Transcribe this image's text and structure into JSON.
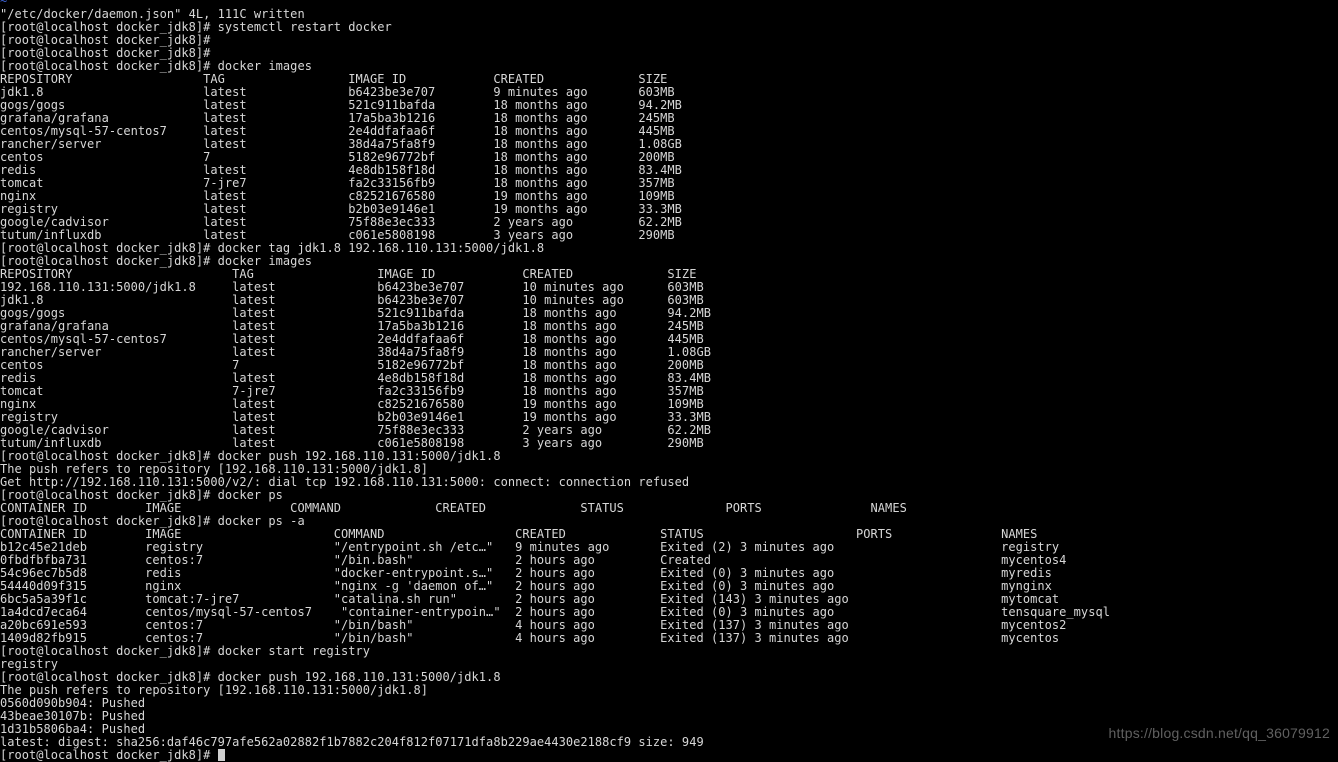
{
  "terminal": {
    "background_color": "#000000",
    "foreground_color": "#d7d7d7",
    "vim_tilde_color": "#3a5fcd",
    "hostname": "localhost",
    "user": "root",
    "working_dir": "docker_jdk8",
    "prompt": "[root@localhost docker_jdk8]# ",
    "vim_tilde": "~",
    "cursor": "block"
  },
  "watermark": {
    "text": "https://blog.csdn.net/qq_36079912",
    "color": "#606060"
  },
  "lines": [
    {
      "type": "tilde",
      "text": "~"
    },
    {
      "type": "output",
      "text": "\"/etc/docker/daemon.json\" 4L, 111C written"
    },
    {
      "type": "command",
      "text": "[root@localhost docker_jdk8]# systemctl restart docker"
    },
    {
      "type": "command",
      "text": "[root@localhost docker_jdk8]#"
    },
    {
      "type": "command",
      "text": "[root@localhost docker_jdk8]#"
    },
    {
      "type": "command",
      "text": "[root@localhost docker_jdk8]# docker images"
    },
    {
      "type": "header",
      "text": "REPOSITORY                  TAG                 IMAGE ID            CREATED             SIZE"
    },
    {
      "type": "output",
      "text": "jdk1.8                      latest              b6423be3e707        9 minutes ago       603MB"
    },
    {
      "type": "output",
      "text": "gogs/gogs                   latest              521c911bafda        18 months ago       94.2MB"
    },
    {
      "type": "output",
      "text": "grafana/grafana             latest              17a5ba3b1216        18 months ago       245MB"
    },
    {
      "type": "output",
      "text": "centos/mysql-57-centos7     latest              2e4ddfafaa6f        18 months ago       445MB"
    },
    {
      "type": "output",
      "text": "rancher/server              latest              38d4a75fa8f9        18 months ago       1.08GB"
    },
    {
      "type": "output",
      "text": "centos                      7                   5182e96772bf        18 months ago       200MB"
    },
    {
      "type": "output",
      "text": "redis                       latest              4e8db158f18d        18 months ago       83.4MB"
    },
    {
      "type": "output",
      "text": "tomcat                      7-jre7              fa2c33156fb9        18 months ago       357MB"
    },
    {
      "type": "output",
      "text": "nginx                       latest              c82521676580        19 months ago       109MB"
    },
    {
      "type": "output",
      "text": "registry                    latest              b2b03e9146e1        19 months ago       33.3MB"
    },
    {
      "type": "output",
      "text": "google/cadvisor             latest              75f88e3ec333        2 years ago         62.2MB"
    },
    {
      "type": "output",
      "text": "tutum/influxdb              latest              c061e5808198        3 years ago         290MB"
    },
    {
      "type": "command",
      "text": "[root@localhost docker_jdk8]# docker tag jdk1.8 192.168.110.131:5000/jdk1.8"
    },
    {
      "type": "command",
      "text": "[root@localhost docker_jdk8]# docker images"
    },
    {
      "type": "header",
      "text": "REPOSITORY                      TAG                 IMAGE ID            CREATED             SIZE"
    },
    {
      "type": "output",
      "text": "192.168.110.131:5000/jdk1.8     latest              b6423be3e707        10 minutes ago      603MB"
    },
    {
      "type": "output",
      "text": "jdk1.8                          latest              b6423be3e707        10 minutes ago      603MB"
    },
    {
      "type": "output",
      "text": "gogs/gogs                       latest              521c911bafda        18 months ago       94.2MB"
    },
    {
      "type": "output",
      "text": "grafana/grafana                 latest              17a5ba3b1216        18 months ago       245MB"
    },
    {
      "type": "output",
      "text": "centos/mysql-57-centos7         latest              2e4ddfafaa6f        18 months ago       445MB"
    },
    {
      "type": "output",
      "text": "rancher/server                  latest              38d4a75fa8f9        18 months ago       1.08GB"
    },
    {
      "type": "output",
      "text": "centos                          7                   5182e96772bf        18 months ago       200MB"
    },
    {
      "type": "output",
      "text": "redis                           latest              4e8db158f18d        18 months ago       83.4MB"
    },
    {
      "type": "output",
      "text": "tomcat                          7-jre7              fa2c33156fb9        18 months ago       357MB"
    },
    {
      "type": "output",
      "text": "nginx                           latest              c82521676580        19 months ago       109MB"
    },
    {
      "type": "output",
      "text": "registry                        latest              b2b03e9146e1        19 months ago       33.3MB"
    },
    {
      "type": "output",
      "text": "google/cadvisor                 latest              75f88e3ec333        2 years ago         62.2MB"
    },
    {
      "type": "output",
      "text": "tutum/influxdb                  latest              c061e5808198        3 years ago         290MB"
    },
    {
      "type": "command",
      "text": "[root@localhost docker_jdk8]# docker push 192.168.110.131:5000/jdk1.8"
    },
    {
      "type": "output",
      "text": "The push refers to repository [192.168.110.131:5000/jdk1.8]"
    },
    {
      "type": "output",
      "text": "Get http://192.168.110.131:5000/v2/: dial tcp 192.168.110.131:5000: connect: connection refused"
    },
    {
      "type": "command",
      "text": "[root@localhost docker_jdk8]# docker ps"
    },
    {
      "type": "header",
      "text": "CONTAINER ID        IMAGE               COMMAND             CREATED             STATUS              PORTS               NAMES"
    },
    {
      "type": "command",
      "text": "[root@localhost docker_jdk8]# docker ps -a"
    },
    {
      "type": "header",
      "text": "CONTAINER ID        IMAGE                     COMMAND                  CREATED             STATUS                     PORTS               NAMES"
    },
    {
      "type": "output",
      "text": "b12c45e21deb        registry                  \"/entrypoint.sh /etc…\"   9 minutes ago       Exited (2) 3 minutes ago                       registry"
    },
    {
      "type": "output",
      "text": "0fbdfbfba731        centos:7                  \"/bin.bash\"              2 hours ago         Created                                        mycentos4"
    },
    {
      "type": "output",
      "text": "54c96ec7b5d8        redis                     \"docker-entrypoint.s…\"   2 hours ago         Exited (0) 3 minutes ago                       myredis"
    },
    {
      "type": "output",
      "text": "54440d09f315        nginx                     \"nginx -g 'daemon of…\"   2 hours ago         Exited (0) 3 minutes ago                       mynginx"
    },
    {
      "type": "output",
      "text": "6bc5a5a39f1c        tomcat:7-jre7             \"catalina.sh run\"        2 hours ago         Exited (143) 3 minutes ago                     mytomcat"
    },
    {
      "type": "output",
      "text": "1a4dcd7eca64        centos/mysql-57-centos7    \"container-entrypoin…\"  2 hours ago         Exited (0) 3 minutes ago                       tensquare_mysql"
    },
    {
      "type": "output",
      "text": "a20bc691e593        centos:7                  \"/bin/bash\"              4 hours ago         Exited (137) 3 minutes ago                     mycentos2"
    },
    {
      "type": "output",
      "text": "1409d82fb915        centos:7                  \"/bin/bash\"              4 hours ago         Exited (137) 3 minutes ago                     mycentos"
    },
    {
      "type": "command",
      "text": "[root@localhost docker_jdk8]# docker start registry"
    },
    {
      "type": "output",
      "text": "registry"
    },
    {
      "type": "command",
      "text": "[root@localhost docker_jdk8]# docker push 192.168.110.131:5000/jdk1.8"
    },
    {
      "type": "output",
      "text": "The push refers to repository [192.168.110.131:5000/jdk1.8]"
    },
    {
      "type": "output",
      "text": "0560d090b904: Pushed"
    },
    {
      "type": "output",
      "text": "43beae30107b: Pushed"
    },
    {
      "type": "output",
      "text": "1d31b5806ba4: Pushed"
    },
    {
      "type": "output",
      "text": "latest: digest: sha256:daf46c797afe562a02882f1b7882c204f812f07171dfa8b229ae4430e2188cf9 size: 949"
    },
    {
      "type": "prompt-cursor",
      "text": "[root@localhost docker_jdk8]# "
    }
  ],
  "docker_images_first": {
    "command": "docker images",
    "columns": [
      "REPOSITORY",
      "TAG",
      "IMAGE ID",
      "CREATED",
      "SIZE"
    ],
    "rows": [
      [
        "jdk1.8",
        "latest",
        "b6423be3e707",
        "9 minutes ago",
        "603MB"
      ],
      [
        "gogs/gogs",
        "latest",
        "521c911bafda",
        "18 months ago",
        "94.2MB"
      ],
      [
        "grafana/grafana",
        "latest",
        "17a5ba3b1216",
        "18 months ago",
        "245MB"
      ],
      [
        "centos/mysql-57-centos7",
        "latest",
        "2e4ddfafaa6f",
        "18 months ago",
        "445MB"
      ],
      [
        "rancher/server",
        "latest",
        "38d4a75fa8f9",
        "18 months ago",
        "1.08GB"
      ],
      [
        "centos",
        "7",
        "5182e96772bf",
        "18 months ago",
        "200MB"
      ],
      [
        "redis",
        "latest",
        "4e8db158f18d",
        "18 months ago",
        "83.4MB"
      ],
      [
        "tomcat",
        "7-jre7",
        "fa2c33156fb9",
        "18 months ago",
        "357MB"
      ],
      [
        "nginx",
        "latest",
        "c82521676580",
        "19 months ago",
        "109MB"
      ],
      [
        "registry",
        "latest",
        "b2b03e9146e1",
        "19 months ago",
        "33.3MB"
      ],
      [
        "google/cadvisor",
        "latest",
        "75f88e3ec333",
        "2 years ago",
        "62.2MB"
      ],
      [
        "tutum/influxdb",
        "latest",
        "c061e5808198",
        "3 years ago",
        "290MB"
      ]
    ]
  },
  "docker_images_second": {
    "command": "docker images",
    "columns": [
      "REPOSITORY",
      "TAG",
      "IMAGE ID",
      "CREATED",
      "SIZE"
    ],
    "rows": [
      [
        "192.168.110.131:5000/jdk1.8",
        "latest",
        "b6423be3e707",
        "10 minutes ago",
        "603MB"
      ],
      [
        "jdk1.8",
        "latest",
        "b6423be3e707",
        "10 minutes ago",
        "603MB"
      ],
      [
        "gogs/gogs",
        "latest",
        "521c911bafda",
        "18 months ago",
        "94.2MB"
      ],
      [
        "grafana/grafana",
        "latest",
        "17a5ba3b1216",
        "18 months ago",
        "245MB"
      ],
      [
        "centos/mysql-57-centos7",
        "latest",
        "2e4ddfafaa6f",
        "18 months ago",
        "445MB"
      ],
      [
        "rancher/server",
        "latest",
        "38d4a75fa8f9",
        "18 months ago",
        "1.08GB"
      ],
      [
        "centos",
        "7",
        "5182e96772bf",
        "18 months ago",
        "200MB"
      ],
      [
        "redis",
        "latest",
        "4e8db158f18d",
        "18 months ago",
        "83.4MB"
      ],
      [
        "tomcat",
        "7-jre7",
        "fa2c33156fb9",
        "18 months ago",
        "357MB"
      ],
      [
        "nginx",
        "latest",
        "c82521676580",
        "19 months ago",
        "109MB"
      ],
      [
        "registry",
        "latest",
        "b2b03e9146e1",
        "19 months ago",
        "33.3MB"
      ],
      [
        "google/cadvisor",
        "latest",
        "75f88e3ec333",
        "2 years ago",
        "62.2MB"
      ],
      [
        "tutum/influxdb",
        "latest",
        "c061e5808198",
        "3 years ago",
        "290MB"
      ]
    ]
  },
  "docker_ps": {
    "command": "docker ps",
    "columns": [
      "CONTAINER ID",
      "IMAGE",
      "COMMAND",
      "CREATED",
      "STATUS",
      "PORTS",
      "NAMES"
    ],
    "rows": []
  },
  "docker_ps_all": {
    "command": "docker ps -a",
    "columns": [
      "CONTAINER ID",
      "IMAGE",
      "COMMAND",
      "CREATED",
      "STATUS",
      "PORTS",
      "NAMES"
    ],
    "rows": [
      [
        "b12c45e21deb",
        "registry",
        "\"/entrypoint.sh /etc…\"",
        "9 minutes ago",
        "Exited (2) 3 minutes ago",
        "",
        "registry"
      ],
      [
        "0fbdfbfba731",
        "centos:7",
        "\"/bin.bash\"",
        "2 hours ago",
        "Created",
        "",
        "mycentos4"
      ],
      [
        "54c96ec7b5d8",
        "redis",
        "\"docker-entrypoint.s…\"",
        "2 hours ago",
        "Exited (0) 3 minutes ago",
        "",
        "myredis"
      ],
      [
        "54440d09f315",
        "nginx",
        "\"nginx -g 'daemon of…\"",
        "2 hours ago",
        "Exited (0) 3 minutes ago",
        "",
        "mynginx"
      ],
      [
        "6bc5a5a39f1c",
        "tomcat:7-jre7",
        "\"catalina.sh run\"",
        "2 hours ago",
        "Exited (143) 3 minutes ago",
        "",
        "mytomcat"
      ],
      [
        "1a4dcd7eca64",
        "centos/mysql-57-centos7",
        "\"container-entrypoin…\"",
        "2 hours ago",
        "Exited (0) 3 minutes ago",
        "",
        "tensquare_mysql"
      ],
      [
        "a20bc691e593",
        "centos:7",
        "\"/bin/bash\"",
        "4 hours ago",
        "Exited (137) 3 minutes ago",
        "",
        "mycentos2"
      ],
      [
        "1409d82fb915",
        "centos:7",
        "\"/bin/bash\"",
        "4 hours ago",
        "Exited (137) 3 minutes ago",
        "",
        "mycentos"
      ]
    ]
  },
  "push_result": {
    "layers": [
      "0560d090b904: Pushed",
      "43beae30107b: Pushed",
      "1d31b5806ba4: Pushed"
    ],
    "digest_line": "latest: digest: sha256:daf46c797afe562a02882f1b7882c204f812f07171dfa8b229ae4430e2188cf9 size: 949",
    "tag": "latest",
    "digest": "sha256:daf46c797afe562a02882f1b7882c204f812f07171dfa8b229ae4430e2188cf9",
    "size": "949"
  }
}
